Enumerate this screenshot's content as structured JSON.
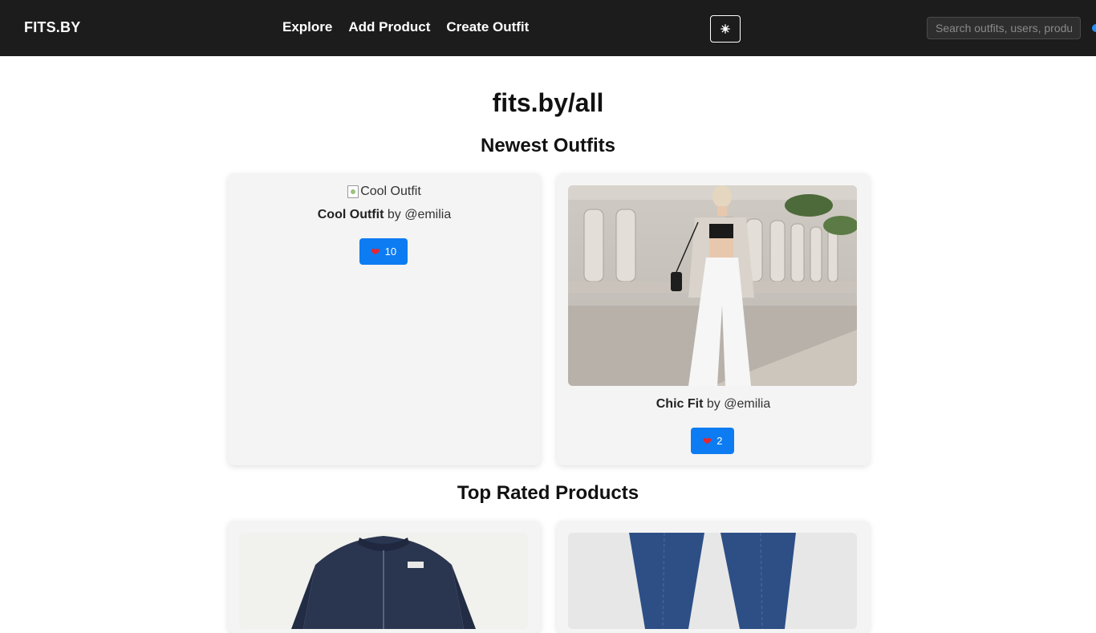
{
  "navbar": {
    "brand": "FITS.BY",
    "links": [
      "Explore",
      "Add Product",
      "Create Outfit"
    ],
    "theme_toggle_icon": "sun-icon",
    "search_placeholder": "Search outfits, users, products"
  },
  "page": {
    "title": "fits.by/all"
  },
  "newest_outfits": {
    "title": "Newest Outfits",
    "items": [
      {
        "image_alt": "Cool Outfit",
        "name": "Cool Outfit",
        "by": "by",
        "user": "@emilia",
        "likes": "10"
      },
      {
        "image_alt": "Chic Fit",
        "name": "Chic Fit",
        "by": "by",
        "user": "@emilia",
        "likes": "2"
      }
    ]
  },
  "top_products": {
    "title": "Top Rated Products"
  },
  "colors": {
    "navbar_bg": "#1c1c1c",
    "like_button": "#0d7cf2",
    "heart": "#e8242d",
    "card_bg": "#f4f4f4"
  }
}
